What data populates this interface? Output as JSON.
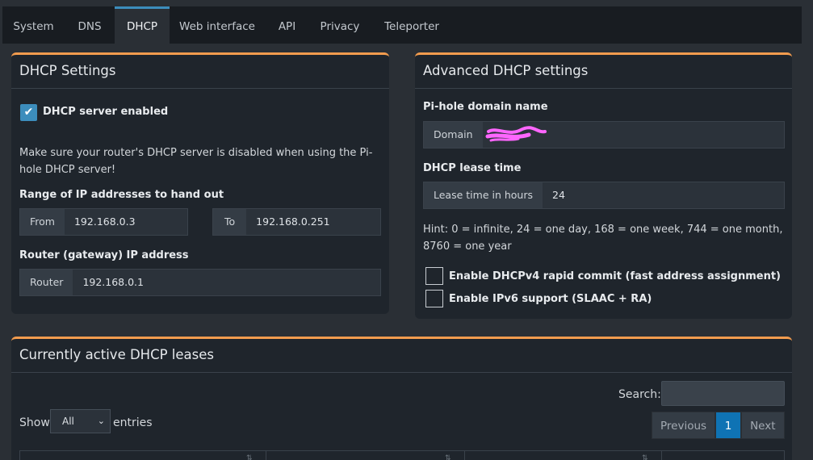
{
  "tabs": [
    {
      "label": "System"
    },
    {
      "label": "DNS"
    },
    {
      "label": "DHCP"
    },
    {
      "label": "Web interface"
    },
    {
      "label": "API"
    },
    {
      "label": "Privacy"
    },
    {
      "label": "Teleporter"
    }
  ],
  "dhcp_settings": {
    "title": "DHCP Settings",
    "enabled_label": "DHCP server enabled",
    "note": "Make sure your router's DHCP server is disabled when using the Pi-hole DHCP server!",
    "range_label": "Range of IP addresses to hand out",
    "from_addon": "From",
    "from_value": "192.168.0.3",
    "to_addon": "To",
    "to_value": "192.168.0.251",
    "router_label": "Router (gateway) IP address",
    "router_addon": "Router",
    "router_value": "192.168.0.1"
  },
  "advanced": {
    "title": "Advanced DHCP settings",
    "domain_label": "Pi-hole domain name",
    "domain_addon": "Domain",
    "lease_label": "DHCP lease time",
    "lease_addon": "Lease time in hours",
    "lease_value": "24",
    "hint": "Hint: 0 = infinite, 24 = one day, 168 = one week, 744 = one month, 8760 = one year",
    "rapid_commit_label": "Enable DHCPv4 rapid commit (fast address assignment)",
    "ipv6_label": "Enable IPv6 support (SLAAC + RA)"
  },
  "leases": {
    "title": "Currently active DHCP leases",
    "search_label": "Search:",
    "show_label": "Show",
    "entries_label": "entries",
    "page_size": "All",
    "prev_label": "Previous",
    "page": "1",
    "next_label": "Next"
  },
  "colors": {
    "accent": "#3c8dbc",
    "box_top_border": "#f39c4e",
    "redaction": "#ff66ff"
  }
}
